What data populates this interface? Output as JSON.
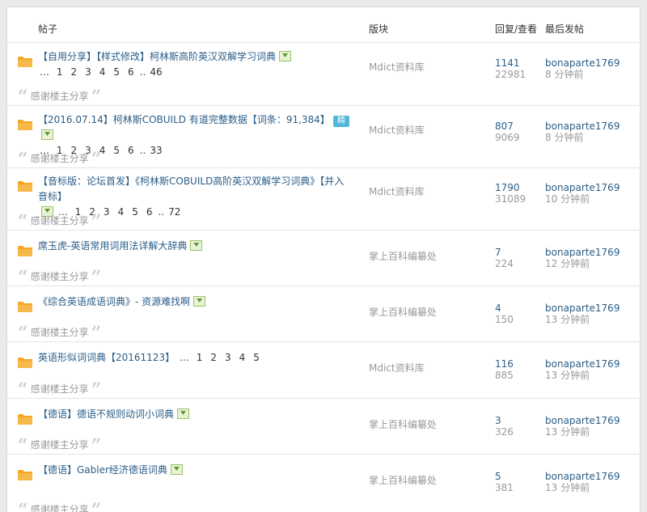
{
  "header": {
    "col_thread": "帖子",
    "col_forum": "版块",
    "col_counts": "回复/查看",
    "col_last": "最后发帖"
  },
  "threads": [
    {
      "title": "【自用分享】【样式修改】柯林斯高阶英汉双解学习词典",
      "pages": [
        "1",
        "2",
        "3",
        "4",
        "5",
        "6",
        "46"
      ],
      "forum": "Mdict资料库",
      "replies": "1141",
      "views": "22981",
      "last_user": "bonaparte1769",
      "last_time": "8 分钟前",
      "quote": "感谢楼主分享"
    },
    {
      "title": "【2016.07.14】柯林斯COBUILD 有道完整数据【词条：91,384】",
      "jing": "精",
      "pages": [
        "1",
        "2",
        "3",
        "4",
        "5",
        "6",
        "33"
      ],
      "forum": "Mdict资料库",
      "replies": "807",
      "views": "9069",
      "last_user": "bonaparte1769",
      "last_time": "8 分钟前",
      "quote": "感谢楼主分享"
    },
    {
      "title": "【音标版：论坛首发】《柯林斯COBUILD高阶英汉双解学习词典》【并入音标】",
      "pages": [
        "1",
        "2",
        "3",
        "4",
        "5",
        "6",
        "72"
      ],
      "forum": "Mdict资料库",
      "replies": "1790",
      "views": "31089",
      "last_user": "bonaparte1769",
      "last_time": "10 分钟前",
      "quote": "感谢楼主分享"
    },
    {
      "title": "席玉虎-英语常用词用法详解大辞典",
      "forum": "掌上百科编纂处",
      "replies": "7",
      "views": "224",
      "last_user": "bonaparte1769",
      "last_time": "12 分钟前",
      "quote": "感谢楼主分享"
    },
    {
      "title": "《综合英语成语词典》- 资源难找啊",
      "forum": "掌上百科编纂处",
      "replies": "4",
      "views": "150",
      "last_user": "bonaparte1769",
      "last_time": "13 分钟前",
      "quote": "感谢楼主分享"
    },
    {
      "title": "英语形似词词典【20161123】",
      "pages": [
        "1",
        "2",
        "3",
        "4",
        "5"
      ],
      "forum": "Mdict资料库",
      "replies": "116",
      "views": "885",
      "last_user": "bonaparte1769",
      "last_time": "13 分钟前",
      "quote": "感谢楼主分享"
    },
    {
      "title": "【德语】德语不规则动词小词典",
      "forum": "掌上百科编纂处",
      "replies": "3",
      "views": "326",
      "last_user": "bonaparte1769",
      "last_time": "13 分钟前",
      "quote": "感谢楼主分享"
    },
    {
      "title": "【德语】Gabler经济德语词典",
      "forum": "掌上百科编纂处",
      "replies": "5",
      "views": "381",
      "last_user": "bonaparte1769",
      "last_time": "13 分钟前",
      "quote": "感谢楼主分享"
    }
  ],
  "colors": {
    "link": "#2a5d87",
    "muted": "#999999",
    "folder": "#f5a623"
  }
}
